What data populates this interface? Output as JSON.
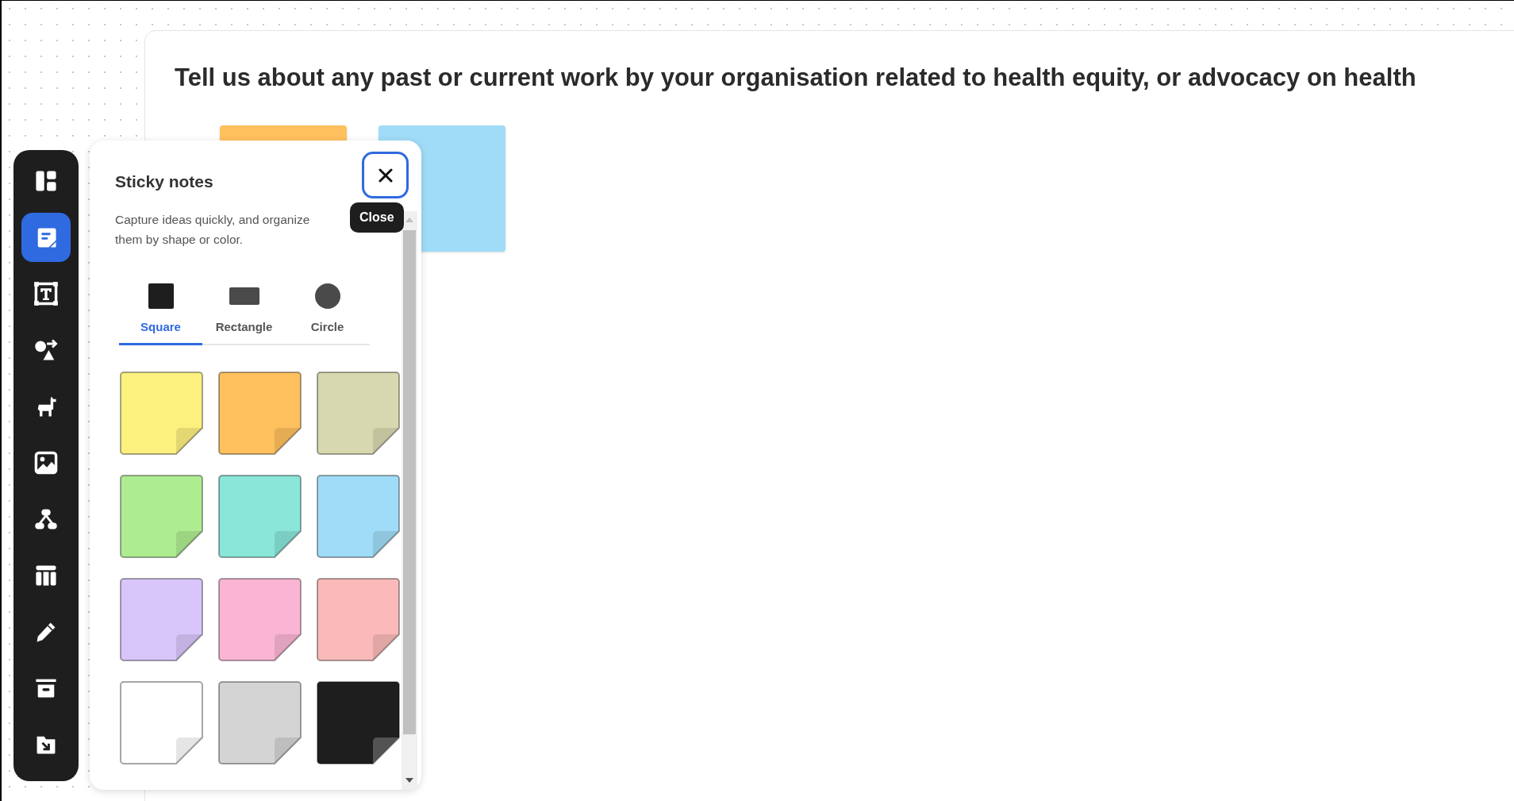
{
  "frame": {
    "heading": "Tell us about any past or current work by your organisation related to health equity, or advocacy on health"
  },
  "canvas_notes": [
    {
      "color": "#ffc05e"
    },
    {
      "color": "#a0dcf7"
    }
  ],
  "toolbar": [
    {
      "kind": "layout",
      "selected": false
    },
    {
      "kind": "sticky",
      "selected": true
    },
    {
      "kind": "text",
      "selected": false
    },
    {
      "kind": "shapes",
      "selected": false
    },
    {
      "kind": "llama",
      "selected": false
    },
    {
      "kind": "image",
      "selected": false
    },
    {
      "kind": "diagram",
      "selected": false
    },
    {
      "kind": "table",
      "selected": false
    },
    {
      "kind": "pencil",
      "selected": false
    },
    {
      "kind": "archive",
      "selected": false
    },
    {
      "kind": "import",
      "selected": false
    }
  ],
  "panel": {
    "title": "Sticky notes",
    "description": "Capture ideas quickly, and organize them by shape or color.",
    "tooltip": "Close",
    "shapes": [
      {
        "kind": "square",
        "label": "Square",
        "selected": true
      },
      {
        "kind": "rectangle",
        "label": "Rectangle",
        "selected": false
      },
      {
        "kind": "circle",
        "label": "Circle",
        "selected": false
      }
    ],
    "colors": [
      {
        "color": "#fcf07f"
      },
      {
        "color": "#ffc05e"
      },
      {
        "color": "#d8d8b0"
      },
      {
        "color": "#aeec91"
      },
      {
        "color": "#89e6d9"
      },
      {
        "color": "#a0dcf7"
      },
      {
        "color": "#d8c6fb"
      },
      {
        "color": "#fbb5d4"
      },
      {
        "color": "#fbbaba"
      },
      {
        "color": "#ffffff"
      },
      {
        "color": "#d4d4d4"
      },
      {
        "color": "#1e1e1e"
      }
    ]
  }
}
